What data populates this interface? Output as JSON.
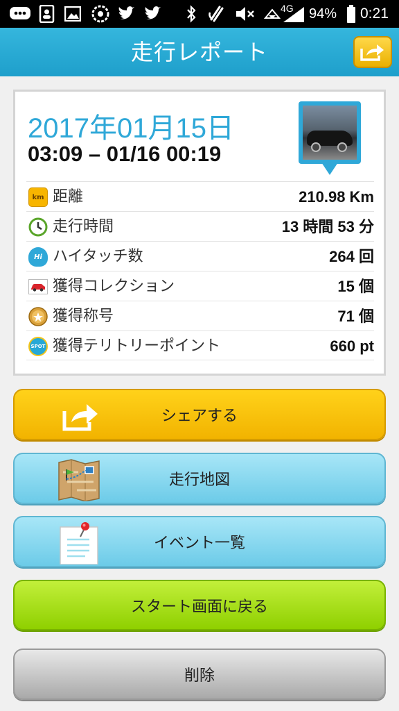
{
  "statusbar": {
    "network": "4G",
    "battery": "94%",
    "time": "0:21",
    "icons": [
      "chat-icon",
      "contacts-icon",
      "gallery-icon",
      "settings-icon",
      "twitter-icon",
      "twitter-icon",
      "bluetooth-icon",
      "nfc-icon",
      "mute-icon",
      "signal-icon",
      "battery-icon"
    ]
  },
  "header": {
    "title": "走行レポート",
    "share_icon": "share-arrow-icon"
  },
  "report": {
    "date": "2017年01月15日",
    "time_range": "03:09 – 01/16 00:19",
    "stats": [
      {
        "icon": "km-icon",
        "icon_text": "km",
        "label": "距離",
        "value": "210.98 Km"
      },
      {
        "icon": "clock-icon",
        "icon_text": "",
        "label": "走行時間",
        "value": "13 時間 53 分"
      },
      {
        "icon": "high-touch-icon",
        "icon_text": "Hi",
        "label": "ハイタッチ数",
        "value": "264 回"
      },
      {
        "icon": "car-collection-icon",
        "icon_text": "",
        "label": "獲得コレクション",
        "value": "15 個"
      },
      {
        "icon": "title-medal-icon",
        "icon_text": "",
        "label": "獲得称号",
        "value": "71 個"
      },
      {
        "icon": "spot-icon",
        "icon_text": "SPOT",
        "label": "獲得テリトリーポイント",
        "value": "660 pt"
      }
    ]
  },
  "buttons": {
    "share": "シェアする",
    "map": "走行地図",
    "events": "イベント一覧",
    "start": "スタート画面に戻る",
    "delete": "削除"
  },
  "colors": {
    "header": "#1e9fcb",
    "date": "#2fa8d8",
    "share_button": "#f2b300",
    "map_button": "#6ccbe8",
    "start_button": "#8fd000",
    "delete_button": "#a9a9a9"
  }
}
